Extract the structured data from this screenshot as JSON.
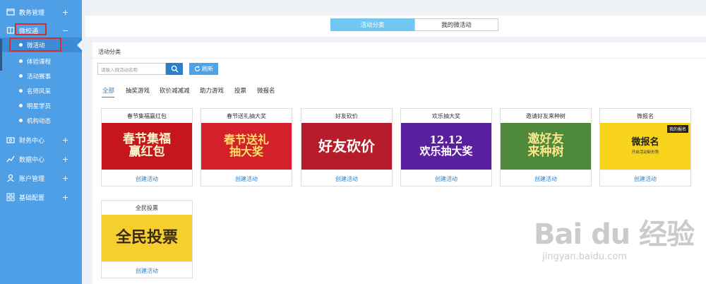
{
  "sidebar": {
    "groups": [
      {
        "label": "教务管理",
        "toggle": "+"
      },
      {
        "label": "微校通",
        "toggle": "−"
      },
      {
        "label": "财务中心",
        "toggle": "+"
      },
      {
        "label": "数据中心",
        "toggle": "+"
      },
      {
        "label": "账户管理",
        "toggle": "+"
      },
      {
        "label": "基础配置",
        "toggle": "+"
      }
    ],
    "sub_items": [
      {
        "label": "微活动"
      },
      {
        "label": "体验课程"
      },
      {
        "label": "活动赛事"
      },
      {
        "label": "名师风采"
      },
      {
        "label": "明星学员"
      },
      {
        "label": "机构动态"
      }
    ]
  },
  "tabs": [
    {
      "label": "活动分类"
    },
    {
      "label": "我的微活动"
    }
  ],
  "panel": {
    "title": "活动分类",
    "search_placeholder": "请输入微活动名称",
    "refresh_label": "刷新"
  },
  "filters": [
    {
      "label": "全部"
    },
    {
      "label": "抽奖游戏"
    },
    {
      "label": "砍价减减减"
    },
    {
      "label": "助力游戏"
    },
    {
      "label": "投票"
    },
    {
      "label": "微报名"
    }
  ],
  "cards": [
    {
      "title": "春节集福赢红包",
      "banner": "春节集福\n赢红包",
      "link": "创建活动"
    },
    {
      "title": "春节送礼抽大奖",
      "banner": "春节送礼\n抽大奖",
      "link": "创建活动"
    },
    {
      "title": "好友砍价",
      "banner": "好友砍价",
      "link": "创建活动"
    },
    {
      "title": "欢乐抽大奖",
      "banner": "12.12\n欢乐抽大奖",
      "link": "创建活动"
    },
    {
      "title": "邀请好友来种树",
      "banner": "邀好友\n来种树",
      "link": "创建活动"
    },
    {
      "title": "微报名",
      "banner": "微报名",
      "banner_sub": "开启活动新形势",
      "banner_badge": "我的报名",
      "link": "创建活动"
    },
    {
      "title": "全民投票",
      "banner": "全民投票",
      "link": "创建活动"
    }
  ],
  "watermark": {
    "main": "Bai du 经验",
    "url": "jingyan.baidu.com"
  },
  "colors": {
    "sidebar_bg": "#4f9fe6",
    "accent": "#2f7fc8",
    "tab_active": "#6fc7f2",
    "highlight_border": "#d32f2f"
  }
}
